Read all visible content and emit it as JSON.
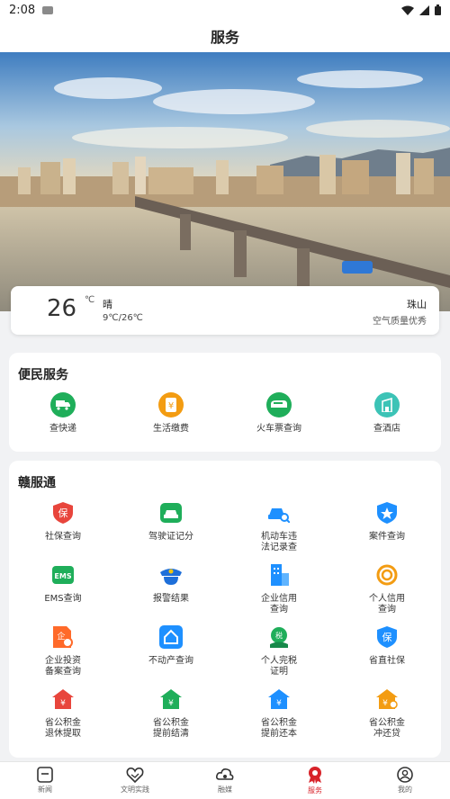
{
  "status_bar": {
    "time": "2:08"
  },
  "header": {
    "title": "服务"
  },
  "weather": {
    "temperature": "26",
    "unit": "℃",
    "condition": "晴",
    "range": "9℃/26℃",
    "location": "珠山",
    "air_quality": "空气质量优秀"
  },
  "convenience": {
    "title": "便民服务",
    "items": [
      {
        "label": "查快递",
        "icon": "delivery-truck-icon",
        "color": "#1fae5a"
      },
      {
        "label": "生活缴费",
        "icon": "bill-payment-icon",
        "color": "#f39c12"
      },
      {
        "label": "火车票查询",
        "icon": "train-icon",
        "color": "#1fae5a"
      },
      {
        "label": "查酒店",
        "icon": "hotel-icon",
        "color": "#3cc3b6"
      }
    ]
  },
  "ganfutong": {
    "title": "赣服通",
    "items": [
      {
        "label": "社保查询",
        "icon": "social-security-shield-icon",
        "color": "#e8453c"
      },
      {
        "label": "驾驶证记分",
        "icon": "car-card-icon",
        "color": "#1fae5a"
      },
      {
        "label": "机动车违\n法记录查",
        "icon": "car-search-icon",
        "color": "#1e90ff"
      },
      {
        "label": "案件查询",
        "icon": "police-badge-icon",
        "color": "#1e90ff"
      },
      {
        "label": "EMS查询",
        "icon": "ems-icon",
        "color": "#1fae5a"
      },
      {
        "label": "报警结果",
        "icon": "police-cap-icon",
        "color": "#1e6fd9"
      },
      {
        "label": "企业信用\n查询",
        "icon": "enterprise-credit-icon",
        "color": "#1e90ff"
      },
      {
        "label": "个人信用\n查询",
        "icon": "personal-credit-icon",
        "color": "#f39c12"
      },
      {
        "label": "企业投资\n备案查询",
        "icon": "investment-filing-icon",
        "color": "#ff6a2a"
      },
      {
        "label": "不动产查询",
        "icon": "real-estate-icon",
        "color": "#1e90ff"
      },
      {
        "label": "个人完税\n证明",
        "icon": "tax-certificate-icon",
        "color": "#1fae5a"
      },
      {
        "label": "省直社保",
        "icon": "provincial-insurance-icon",
        "color": "#1e90ff"
      },
      {
        "label": "省公积金\n退休提取",
        "icon": "fund-retire-icon",
        "color": "#e8453c"
      },
      {
        "label": "省公积金\n提前结清",
        "icon": "fund-settle-icon",
        "color": "#1fae5a"
      },
      {
        "label": "省公积金\n提前还本",
        "icon": "fund-repay-icon",
        "color": "#1e90ff"
      },
      {
        "label": "省公积金\n冲还贷",
        "icon": "fund-offset-icon",
        "color": "#f39c12"
      }
    ]
  },
  "tabs": [
    {
      "label": "新闻",
      "icon": "news-icon",
      "active": false
    },
    {
      "label": "文明实践",
      "icon": "heart-hands-icon",
      "active": false
    },
    {
      "label": "融媒",
      "icon": "cloud-media-icon",
      "active": false
    },
    {
      "label": "服务",
      "icon": "service-badge-icon",
      "active": true
    },
    {
      "label": "我的",
      "icon": "profile-icon",
      "active": false
    }
  ]
}
